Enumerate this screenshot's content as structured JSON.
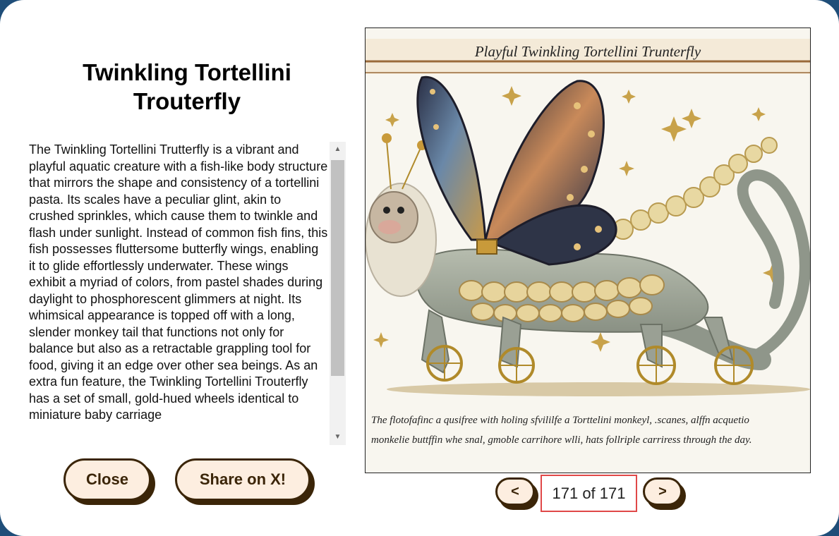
{
  "modal": {
    "title": "Twinkling Tortellini Trouterfly",
    "description": "The Twinkling Tortellini Trutterfly is a vibrant and playful aquatic creature with a fish-like body structure that mirrors the shape and consistency of a tortellini pasta. Its scales have a peculiar glint, akin to crushed sprinkles, which cause them to twinkle and flash under sunlight. Instead of common fish fins, this fish possesses fluttersome butterfly wings, enabling it to glide effortlessly underwater. These wings exhibit a myriad of colors, from pastel shades during daylight to phosphorescent glimmers at night. Its whimsical appearance is topped off with a long, slender monkey tail that functions not only for balance but also as a retractable grappling tool for food, giving it an edge over other sea beings. As an extra fun feature, the Twinkling Tortellini Trouterfly has a set of small, gold-hued wheels identical to miniature baby carriage",
    "close_label": "Close",
    "share_label": "Share on X!",
    "prev_label": "<",
    "next_label": ">",
    "counter": "171 of 171",
    "image": {
      "caption_top": "Playful Twinkling Tortellini Trunterfly",
      "caption_bottom_1": "The flotofafinc a qusifree with holing sfvililfe a Torttelini monkeyl, .scanes, alffn acquetio",
      "caption_bottom_2": "monkelie buttffin whe snal, gmoble carrihore wlli, hats follriple carriress through the day."
    }
  },
  "colors": {
    "backdrop": "#1f4e79",
    "button_bg": "#fdeee0",
    "button_border": "#3b2508",
    "counter_border": "#e04848"
  }
}
